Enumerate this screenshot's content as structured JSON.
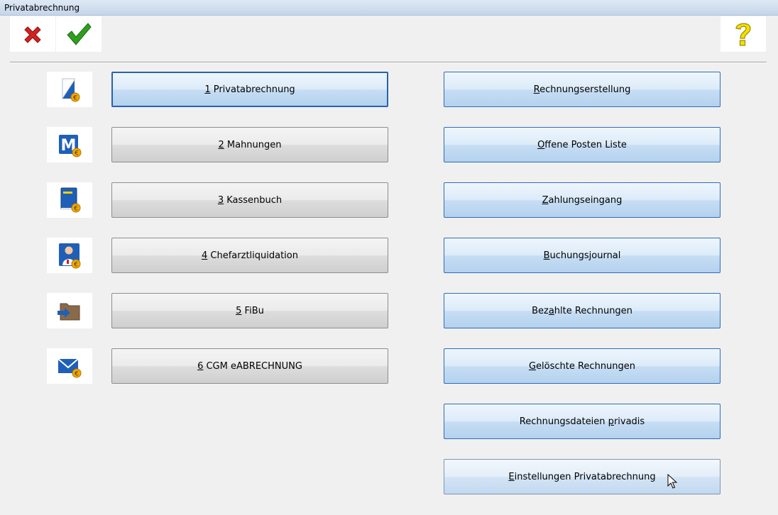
{
  "window": {
    "title": "Privatabrechnung"
  },
  "toolbar": {
    "cancel_icon": "red-x-icon",
    "ok_icon": "green-check-icon",
    "help_icon": "yellow-question-icon"
  },
  "left_buttons": [
    {
      "key": "1",
      "rest": " Privatabrechnung",
      "icon": "document-euro-icon"
    },
    {
      "key": "2",
      "rest": " Mahnungen",
      "icon": "mahnung-m-euro-icon"
    },
    {
      "key": "3",
      "rest": " Kassenbuch",
      "icon": "cashbook-euro-icon"
    },
    {
      "key": "4",
      "rest": " Chefarztliquidation",
      "icon": "doctor-euro-icon"
    },
    {
      "key": "5",
      "rest": " FiBu",
      "icon": "folder-arrow-icon"
    },
    {
      "key": "6",
      "rest": " CGM eABRECHNUNG",
      "icon": "envelope-euro-icon"
    }
  ],
  "right_buttons": [
    {
      "pre": "",
      "key": "R",
      "post": "echnungserstellung"
    },
    {
      "pre": "",
      "key": "O",
      "post": "ffene Posten Liste"
    },
    {
      "pre": "",
      "key": "Z",
      "post": "ahlungseingang"
    },
    {
      "pre": "",
      "key": "B",
      "post": "uchungsjournal"
    },
    {
      "pre": "Bez",
      "key": "a",
      "post": "hlte Rechnungen"
    },
    {
      "pre": "",
      "key": "G",
      "post": "elöschte Rechnungen"
    },
    {
      "pre": "Rechnungsdateien ",
      "key": "p",
      "post": "rivadis"
    },
    {
      "pre": "",
      "key": "E",
      "post": "instellungen Privatabrechnung"
    }
  ],
  "colors": {
    "accent_blue": "#2f6cb5",
    "cancel_red": "#d42020",
    "ok_green": "#2f9e1e",
    "help_yellow": "#f2e000"
  }
}
